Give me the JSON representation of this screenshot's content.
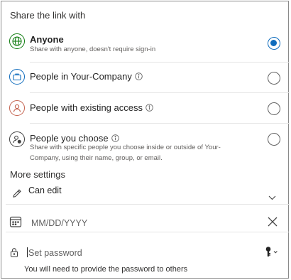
{
  "share_section_title": "Share the link with",
  "options": [
    {
      "title": "Anyone",
      "description": "Share with anyone, doesn't require sign-in",
      "selected": true,
      "icon": "globe-icon"
    },
    {
      "title": "People in Your-Company",
      "selected": false,
      "icon": "briefcase-icon"
    },
    {
      "title": "People with existing access",
      "selected": false,
      "icon": "person-icon"
    },
    {
      "title": "People you choose",
      "description": "Share with specific people you choose inside or outside of Your-Company, using their name, group, or email.",
      "selected": false,
      "icon": "person-settings-icon"
    }
  ],
  "more_settings_title": "More settings",
  "permission": {
    "label": "Can edit",
    "icon": "pencil-icon"
  },
  "expiry": {
    "placeholder": "MM/DD/YYYY",
    "icon": "calendar-icon"
  },
  "password": {
    "placeholder": "Set password",
    "hint": "You will need to provide the password to others",
    "icon": "lock-icon"
  },
  "colors": {
    "accent": "#0f6cbd",
    "globe": "#107c10",
    "company": "#0f6cbd",
    "person": "#c4634f",
    "neutral": "#424242"
  }
}
